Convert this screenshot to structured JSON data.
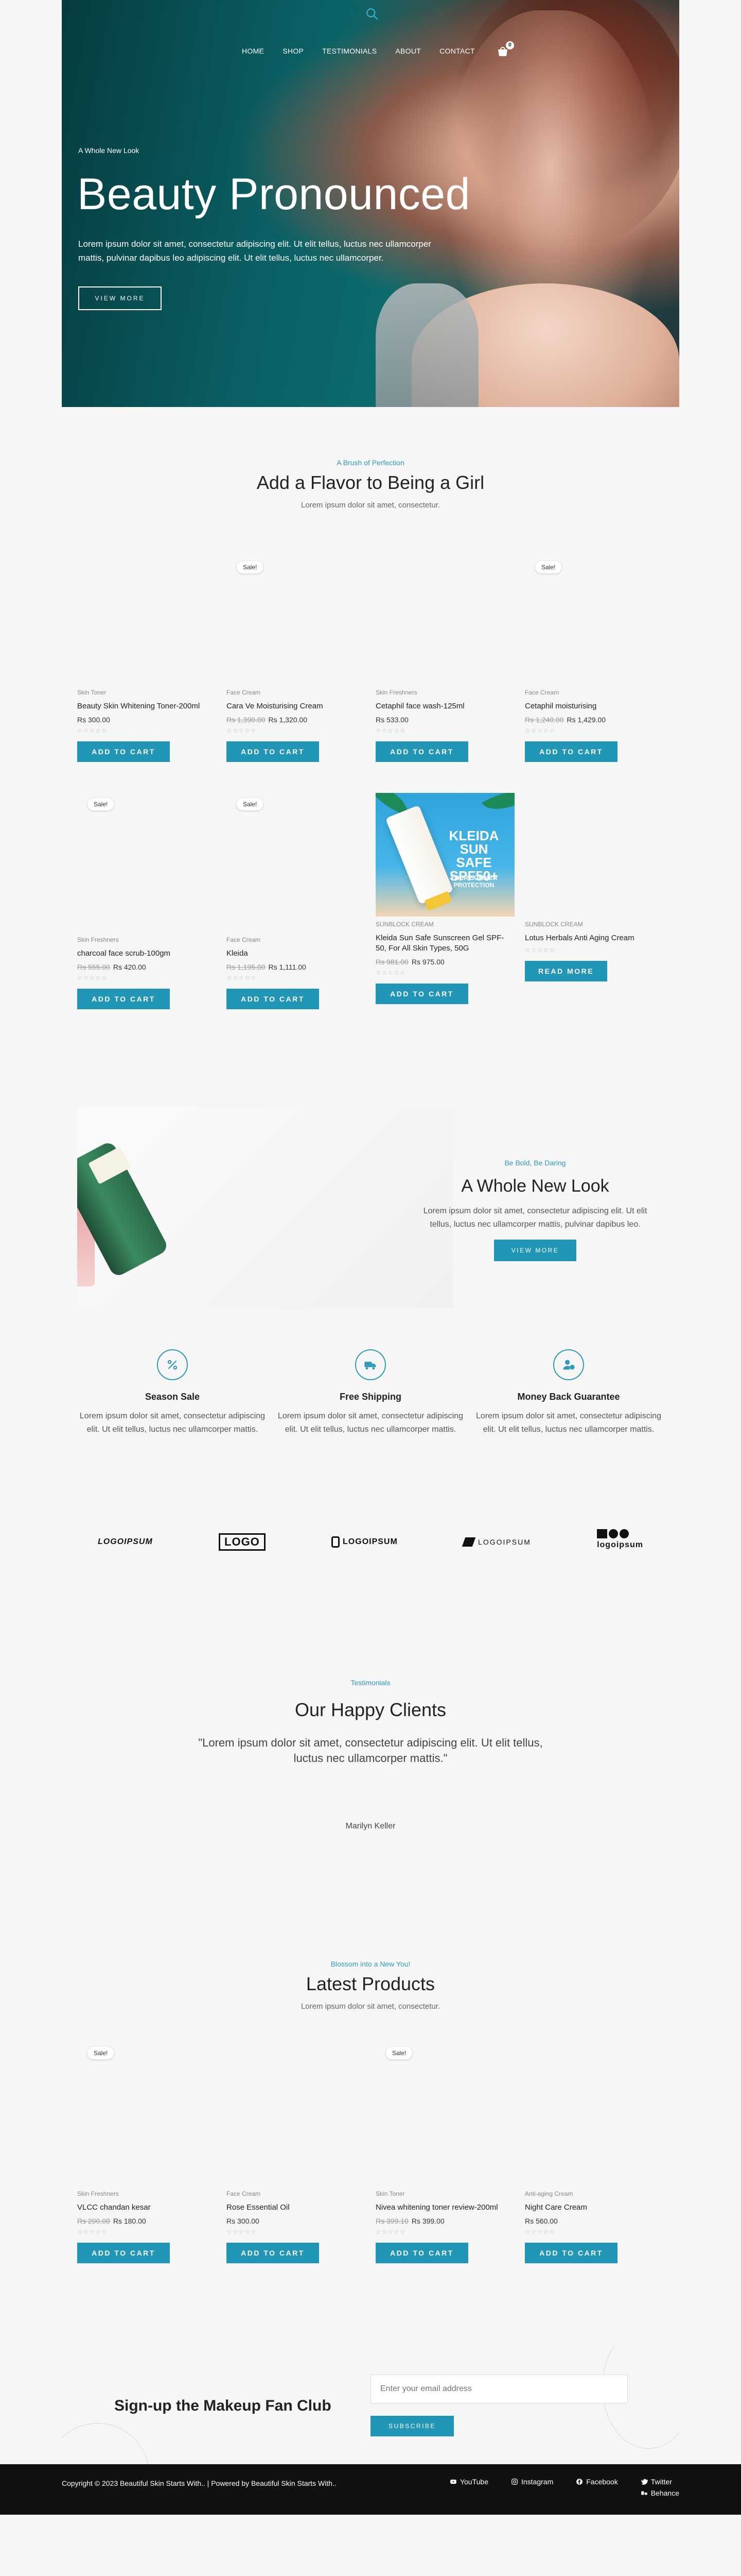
{
  "nav": {
    "items": [
      "HOME",
      "SHOP",
      "TESTIMONIALS",
      "ABOUT",
      "CONTACT"
    ],
    "cart_count": "0"
  },
  "hero": {
    "kicker": "A Whole New Look",
    "title": "Beauty Pronounced",
    "text": "Lorem ipsum dolor sit amet, consectetur adipiscing elit. Ut elit tellus, luctus nec ullamcorper mattis, pulvinar dapibus leo adipiscing elit. Ut elit tellus, luctus nec ullamcorper.",
    "button": "VIEW MORE"
  },
  "flavor": {
    "kicker": "A Brush of Perfection",
    "title": "Add a Flavor to Being a Girl",
    "sub": "Lorem ipsum dolor sit amet, consectetur."
  },
  "products": [
    {
      "sale": "Sale!",
      "cat": "Skin Toner",
      "name": "Beauty Skin Whitening Toner-200ml",
      "old": "",
      "price": "Rs 300.00",
      "stars": "☆☆☆☆☆",
      "btn": "ADD TO CART"
    },
    {
      "sale": "",
      "cat": "Face Cream",
      "name": "Cara Ve Moisturising Cream",
      "old": "Rs 1,390.00",
      "price": "Rs 1,320.00",
      "stars": "☆☆☆☆☆",
      "btn": "ADD TO CART"
    },
    {
      "sale": "",
      "cat": "Skin Freshners",
      "name": "Cetaphil face wash-125ml",
      "old": "",
      "price": "Rs 533.00",
      "stars": "☆☆☆☆☆",
      "btn": "ADD TO CART"
    },
    {
      "sale": "Sale!",
      "cat": "Face Cream",
      "name": "Cetaphil moisturising",
      "old": "Rs 1,240.00",
      "price": "Rs 1,429.00",
      "stars": "☆☆☆☆☆",
      "btn": "ADD TO CART"
    },
    {
      "sale": "Sale!",
      "cat": "Skin Freshners",
      "name": "charcoal face scrub-100gm",
      "old": "Rs 555.00",
      "price": "Rs 420.00",
      "stars": "☆☆☆☆☆",
      "btn": "ADD TO CART"
    },
    {
      "sale": "Sale!",
      "cat": "Face Cream",
      "name": "Kleida",
      "old": "Rs 1,195.00",
      "price": "Rs 1,111.00",
      "stars": "☆☆☆☆☆",
      "btn": "ADD TO CART"
    },
    {
      "sale": "",
      "cat": "SUNBLOCK CREAM",
      "name": "Kleida Sun Safe Sunscreen Gel SPF-50, For All Skin Types, 50G",
      "old": "Rs 981.00",
      "price": "Rs 975.00",
      "stars": "☆☆☆☆☆",
      "btn": "ADD TO CART",
      "image_text": {
        "title": "KLEIDA SUN SAFE SPF50+",
        "sub": "YOUR SUMMER PROTECTION"
      }
    },
    {
      "sale": "",
      "cat": "SUNBLOCK CREAM",
      "name": "Lotus Herbals Anti Aging Cream",
      "old": "",
      "price": "",
      "stars": "☆☆☆☆☆",
      "btn": "READ MORE"
    }
  ],
  "feature": {
    "kicker": "Be Bold, Be Daring",
    "title": "A Whole New Look",
    "text": "Lorem ipsum dolor sit amet, consectetur adipiscing elit. Ut elit tellus, luctus nec ullamcorper mattis, pulvinar dapibus leo.",
    "button": "VIEW MORE"
  },
  "services": [
    {
      "icon": "percent-icon",
      "title": "Season Sale",
      "text": "Lorem ipsum dolor sit amet, consectetur adipiscing elit. Ut elit tellus, luctus nec ullamcorper mattis."
    },
    {
      "icon": "truck-icon",
      "title": "Free Shipping",
      "text": "Lorem ipsum dolor sit amet, consectetur adipiscing elit. Ut elit tellus, luctus nec ullamcorper mattis."
    },
    {
      "icon": "money-back-icon",
      "title": "Money Back Guarantee",
      "text": "Lorem ipsum dolor sit amet, consectetur adipiscing elit. Ut elit tellus, luctus nec ullamcorper mattis."
    }
  ],
  "logos": [
    "LOGOIPSUM",
    "LOGO",
    "LOGOIPSUM",
    "LOGOIPSUM",
    "logoipsum"
  ],
  "testimonials": {
    "kicker": "Testimonials",
    "title": "Our Happy Clients",
    "quote": "\"Lorem ipsum dolor sit amet, consectetur adipiscing elit. Ut elit tellus, luctus nec ullamcorper mattis.\"",
    "author": "Marilyn Keller"
  },
  "latest": {
    "kicker": "Blossom into a New You!",
    "title": "Latest Products",
    "sub": "Lorem ipsum dolor sit amet, consectetur."
  },
  "latest_products": [
    {
      "sale": "Sale!",
      "cat": "Skin Freshners",
      "name": "VLCC chandan kesar",
      "old": "Rs 200.00",
      "price": "Rs 180.00",
      "stars": "☆☆☆☆☆",
      "btn": "ADD TO CART"
    },
    {
      "sale": "",
      "cat": "Face Cream",
      "name": "Rose Essential Oil",
      "old": "",
      "price": "Rs 300.00",
      "stars": "☆☆☆☆☆",
      "btn": "ADD TO CART"
    },
    {
      "sale": "Sale!",
      "cat": "Skin Toner",
      "name": "Nivea whitening toner review-200ml",
      "old": "Rs 399.10",
      "price": "Rs 399.00",
      "stars": "☆☆☆☆☆",
      "btn": "ADD TO CART"
    },
    {
      "sale": "",
      "cat": "Anti-aging Cream",
      "name": "Night Care Cream",
      "old": "",
      "price": "Rs 560.00",
      "stars": "☆☆☆☆☆",
      "btn": "ADD TO CART"
    }
  ],
  "signup": {
    "title": "Sign-up the Makeup Fan Club",
    "placeholder": "Enter your email address",
    "button": "SUBSCRIBE"
  },
  "footer": {
    "copyright": "Copyright © 2023 Beautiful Skin Starts With.. | Powered by Beautiful Skin Starts With..",
    "socials": [
      "YouTube",
      "Instagram",
      "Facebook",
      "Twitter",
      "Behance"
    ]
  },
  "colors": {
    "accent": "#2196b7",
    "kicker": "#2f9bb9",
    "footer": "#111111",
    "background": "#f6f6f6"
  }
}
